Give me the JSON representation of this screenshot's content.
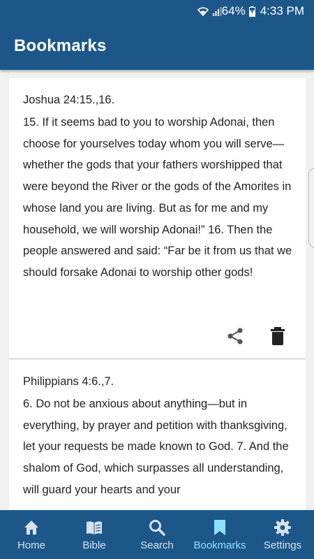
{
  "status": {
    "battery": "64%",
    "time": "4:33 PM",
    "icons": [
      "wifi-icon",
      "signal-icon",
      "battery-charging-icon"
    ]
  },
  "appbar": {
    "title": "Bookmarks"
  },
  "bookmarks": [
    {
      "reference": "Joshua 24:15.,16.",
      "text": "15. If it seems bad to you to worship Adonai, then choose for yourselves today whom you will serve—whether the gods that your fathers worshipped that were beyond the River or the gods of the Amorites in whose land you are living. But as for me and my household, we will worship Adonai!” 16. Then the people answered and said: “Far be it from us that we should forsake Adonai to worship other gods!",
      "actions": [
        "share-icon",
        "delete-icon"
      ]
    },
    {
      "reference": "Philippians 4:6.,7.",
      "text": "6. Do not be anxious about anything—but in everything, by prayer and petition with thanksgiving, let your requests be made known to God. 7. And the shalom of God, which surpasses all understanding, will guard your hearts and your"
    }
  ],
  "nav": {
    "items": [
      {
        "label": "Home",
        "icon": "home-icon"
      },
      {
        "label": "Bible",
        "icon": "book-icon"
      },
      {
        "label": "Search",
        "icon": "search-icon"
      },
      {
        "label": "Bookmarks",
        "icon": "bookmark-icon",
        "active": true
      },
      {
        "label": "Settings",
        "icon": "gear-icon"
      }
    ]
  },
  "colors": {
    "primary": "#1d578a",
    "active_tab": "#8ee1fb",
    "inactive_tab": "#d7e2ec"
  }
}
